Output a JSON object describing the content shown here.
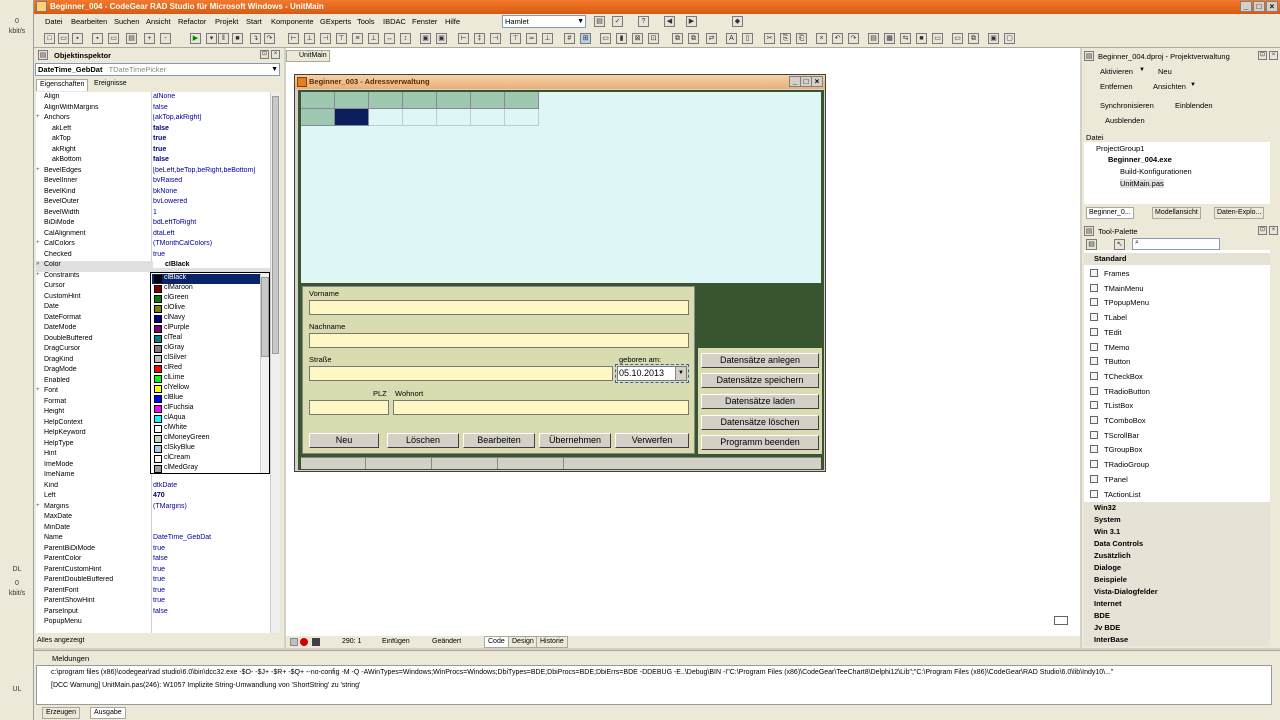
{
  "left_strip": {
    "top_value": "0",
    "top_unit": "kbit/s",
    "dl_label": "DL",
    "bottom_value": "0",
    "bottom_unit": "kbit/s",
    "ul_label": "UL"
  },
  "window": {
    "title": "Beginner_004 - CodeGear RAD Studio für Microsoft Windows - UnitMain"
  },
  "menu": {
    "items": [
      "Datei",
      "Bearbeiten",
      "Suchen",
      "Ansicht",
      "Refactor",
      "Projekt",
      "Start",
      "Komponente",
      "GExperts",
      "Tools",
      "IBDAC",
      "Fenster",
      "Hilfe"
    ],
    "layout_combo": "Hamlet"
  },
  "object_inspector": {
    "title": "Objektinspektor",
    "selected_object": "DateTime_GebDat",
    "selected_type": "TDateTimePicker",
    "tabs": [
      "Eigenschaften",
      "Ereignisse"
    ],
    "status": "Alles angezeigt",
    "properties": [
      {
        "name": "Align",
        "value": "alNone"
      },
      {
        "name": "AlignWithMargins",
        "value": "false"
      },
      {
        "name": "Anchors",
        "value": "[akTop,akRight]"
      },
      {
        "name": "akLeft",
        "value": "false"
      },
      {
        "name": "akTop",
        "value": "true"
      },
      {
        "name": "akRight",
        "value": "true"
      },
      {
        "name": "akBottom",
        "value": "false"
      },
      {
        "name": "BevelEdges",
        "value": "[beLeft,beTop,beRight,beBottom]"
      },
      {
        "name": "BevelInner",
        "value": "bvRaised"
      },
      {
        "name": "BevelKind",
        "value": "bkNone"
      },
      {
        "name": "BevelOuter",
        "value": "bvLowered"
      },
      {
        "name": "BevelWidth",
        "value": "1"
      },
      {
        "name": "BiDiMode",
        "value": "bdLeftToRight"
      },
      {
        "name": "CalAlignment",
        "value": "dtaLeft"
      },
      {
        "name": "CalColors",
        "value": "(TMonthCalColors)"
      },
      {
        "name": "Checked",
        "value": "true"
      },
      {
        "name": "Color",
        "value": "clBlack"
      },
      {
        "name": "Constraints",
        "value": ""
      },
      {
        "name": "Cursor",
        "value": ""
      },
      {
        "name": "CustomHint",
        "value": ""
      },
      {
        "name": "Date",
        "value": ""
      },
      {
        "name": "DateFormat",
        "value": ""
      },
      {
        "name": "DateMode",
        "value": ""
      },
      {
        "name": "DoubleBuffered",
        "value": ""
      },
      {
        "name": "DragCursor",
        "value": ""
      },
      {
        "name": "DragKind",
        "value": ""
      },
      {
        "name": "DragMode",
        "value": ""
      },
      {
        "name": "Enabled",
        "value": ""
      },
      {
        "name": "Font",
        "value": ""
      },
      {
        "name": "Format",
        "value": ""
      },
      {
        "name": "Height",
        "value": ""
      },
      {
        "name": "HelpContext",
        "value": ""
      },
      {
        "name": "HelpKeyword",
        "value": ""
      },
      {
        "name": "HelpType",
        "value": ""
      },
      {
        "name": "Hint",
        "value": ""
      },
      {
        "name": "ImeMode",
        "value": ""
      },
      {
        "name": "ImeName",
        "value": ""
      },
      {
        "name": "Kind",
        "value": "dtkDate"
      },
      {
        "name": "Left",
        "value": "470"
      },
      {
        "name": "Margins",
        "value": "(TMargins)"
      },
      {
        "name": "MaxDate",
        "value": ""
      },
      {
        "name": "MinDate",
        "value": ""
      },
      {
        "name": "Name",
        "value": "DateTime_GebDat"
      },
      {
        "name": "ParentBiDiMode",
        "value": "true"
      },
      {
        "name": "ParentColor",
        "value": "false"
      },
      {
        "name": "ParentCustomHint",
        "value": "true"
      },
      {
        "name": "ParentDoubleBuffered",
        "value": "true"
      },
      {
        "name": "ParentFont",
        "value": "true"
      },
      {
        "name": "ParentShowHint",
        "value": "true"
      },
      {
        "name": "ParseInput",
        "value": "false"
      },
      {
        "name": "PopupMenu",
        "value": ""
      }
    ],
    "color_list": [
      {
        "name": "clBlack",
        "hex": "#000000"
      },
      {
        "name": "clMaroon",
        "hex": "#800000"
      },
      {
        "name": "clGreen",
        "hex": "#008000"
      },
      {
        "name": "clOlive",
        "hex": "#808000"
      },
      {
        "name": "clNavy",
        "hex": "#000080"
      },
      {
        "name": "clPurple",
        "hex": "#800080"
      },
      {
        "name": "clTeal",
        "hex": "#008080"
      },
      {
        "name": "clGray",
        "hex": "#808080"
      },
      {
        "name": "clSilver",
        "hex": "#c0c0c0"
      },
      {
        "name": "clRed",
        "hex": "#ff0000"
      },
      {
        "name": "clLime",
        "hex": "#00ff00"
      },
      {
        "name": "clYellow",
        "hex": "#ffff00"
      },
      {
        "name": "clBlue",
        "hex": "#0000ff"
      },
      {
        "name": "clFuchsia",
        "hex": "#ff00ff"
      },
      {
        "name": "clAqua",
        "hex": "#00ffff"
      },
      {
        "name": "clWhite",
        "hex": "#ffffff"
      },
      {
        "name": "clMoneyGreen",
        "hex": "#c0dcc0"
      },
      {
        "name": "clSkyBlue",
        "hex": "#a6caf0"
      },
      {
        "name": "clCream",
        "hex": "#fffbf0"
      },
      {
        "name": "clMedGray",
        "hex": "#a0a0a4"
      }
    ]
  },
  "editor": {
    "tab": "UnitMain",
    "status": {
      "position": "290: 1",
      "mode": "Einfügen",
      "modified": "Geändert",
      "tabs": [
        "Code",
        "Design",
        "Historie"
      ]
    }
  },
  "form": {
    "title": "Beginner_003 - Adressverwaltung",
    "labels": {
      "vorname": "Vorname",
      "nachname": "Nachname",
      "strasse": "Straße",
      "geboren": "geboren am:",
      "plz": "PLZ",
      "wohnort": "Wohnort"
    },
    "date_value": "05.10.2013",
    "bottom_buttons": [
      "Neu",
      "Löschen",
      "Bearbeiten",
      "Übernehmen",
      "Verwerfen"
    ],
    "right_buttons": [
      "Datensätze anlegen",
      "Datensätze speichern",
      "Datensätze laden",
      "Datensätze löschen",
      "Programm beenden"
    ]
  },
  "project_manager": {
    "title": "Beginner_004.dproj - Projektverwaltung",
    "actions": [
      "Aktivieren",
      "Neu",
      "Entfernen",
      "Ansichten",
      "Synchronisieren",
      "Einblenden",
      "Ausblenden"
    ],
    "file_header": "Datei",
    "tree": [
      "ProjectGroup1",
      "Beginner_004.exe",
      "Build-Konfigurationen",
      "UnitMain.pas"
    ],
    "tabs": [
      "Beginner_0...",
      "Modellansicht",
      "Daten-Explo..."
    ]
  },
  "tool_palette": {
    "title": "Tool-Palette",
    "categories_open": "Standard",
    "items": [
      "Frames",
      "TMainMenu",
      "TPopupMenu",
      "TLabel",
      "TEdit",
      "TMemo",
      "TButton",
      "TCheckBox",
      "TRadioButton",
      "TListBox",
      "TComboBox",
      "TScrollBar",
      "TGroupBox",
      "TRadioGroup",
      "TPanel",
      "TActionList"
    ],
    "categories": [
      "Win32",
      "System",
      "Win 3.1",
      "Data Controls",
      "Zusätzlich",
      "Dialoge",
      "Beispiele",
      "Vista-Dialogfelder",
      "Internet",
      "BDE",
      "Jv BDE",
      "InterBase"
    ]
  },
  "messages": {
    "title": "Meldungen",
    "lines": [
      "c:\\program files (x86)\\codegear\\rad studio\\6.0\\bin\\dcc32.exe -$O- -$J+ -$R+ -$Q+ --no-config -M -Q -AWinTypes=Windows;WinProcs=Windows;DbiTypes=BDE;DbiProcs=BDE;DbiErrs=BDE -DDEBUG -E..\\Debug\\BIN -I\"C:\\Program Files (x86)\\CodeGear\\TeeChart8\\Delphi12\\Lib\";\"C:\\Program Files (x86)\\CodeGear\\RAD Studio\\6.0\\lib\\Indy10\\...\"",
      "[DCC Warnung] UnitMain.pas(246): W1057 Implizite String-Umwandlung von 'ShortString' zu 'string'"
    ],
    "bottom_tabs": [
      "Erzeugen",
      "Ausgabe"
    ]
  }
}
